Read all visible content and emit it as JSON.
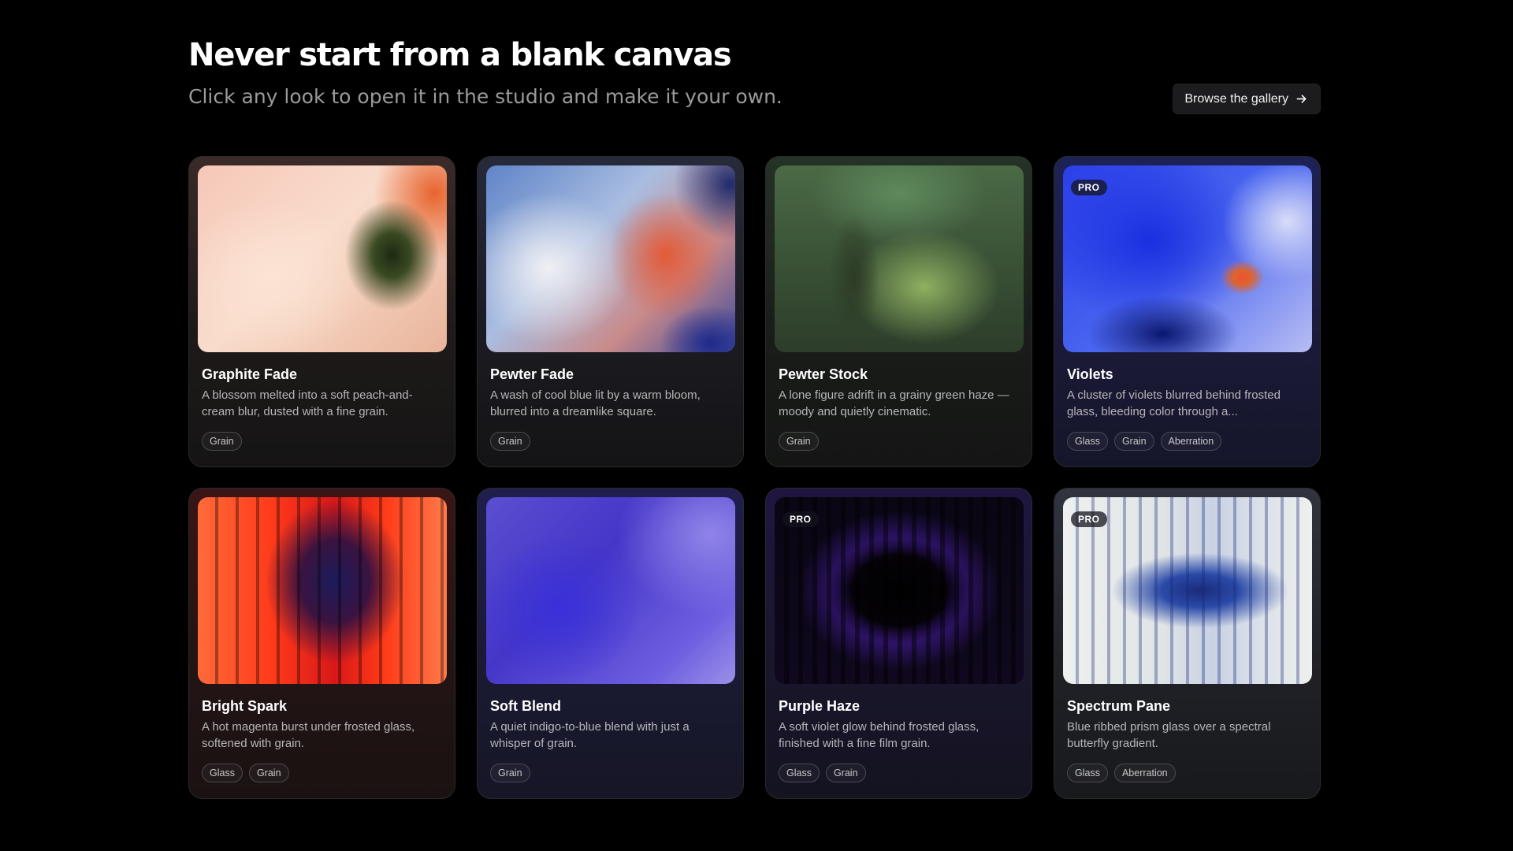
{
  "header": {
    "title": "Never start from a blank canvas",
    "subtitle": "Click any look to open it in the studio and make it your own.",
    "browse_label": "Browse the gallery"
  },
  "cards": [
    {
      "title": "Graphite Fade",
      "description": "A blossom melted into a soft peach-and-cream blur, dusted with a fine grain.",
      "tags": [
        "Grain"
      ],
      "pro": false
    },
    {
      "title": "Pewter Fade",
      "description": "A wash of cool blue lit by a warm bloom, blurred into a dreamlike square.",
      "tags": [
        "Grain"
      ],
      "pro": false
    },
    {
      "title": "Pewter Stock",
      "description": "A lone figure adrift in a grainy green haze — moody and quietly cinematic.",
      "tags": [
        "Grain"
      ],
      "pro": false
    },
    {
      "title": "Violets",
      "description": "A cluster of violets blurred behind frosted glass, bleeding color through a...",
      "tags": [
        "Glass",
        "Grain",
        "Aberration"
      ],
      "pro": true,
      "pro_label": "PRO"
    },
    {
      "title": "Bright Spark",
      "description": "A hot magenta burst under frosted glass, softened with grain.",
      "tags": [
        "Glass",
        "Grain"
      ],
      "pro": false
    },
    {
      "title": "Soft Blend",
      "description": "A quiet indigo-to-blue blend with just a whisper of grain.",
      "tags": [
        "Grain"
      ],
      "pro": false
    },
    {
      "title": "Purple Haze",
      "description": "A soft violet glow behind frosted glass, finished with a fine film grain.",
      "tags": [
        "Glass",
        "Grain"
      ],
      "pro": true,
      "pro_label": "PRO"
    },
    {
      "title": "Spectrum Pane",
      "description": "Blue ribbed prism glass over a spectral butterfly gradient.",
      "tags": [
        "Glass",
        "Aberration"
      ],
      "pro": true,
      "pro_label": "PRO"
    }
  ],
  "icons": {
    "browse": "arrow-right-icon"
  },
  "colors": {
    "background": "#000000",
    "button_bg": "#1c1c1e",
    "subtitle": "#9a9a9a"
  }
}
